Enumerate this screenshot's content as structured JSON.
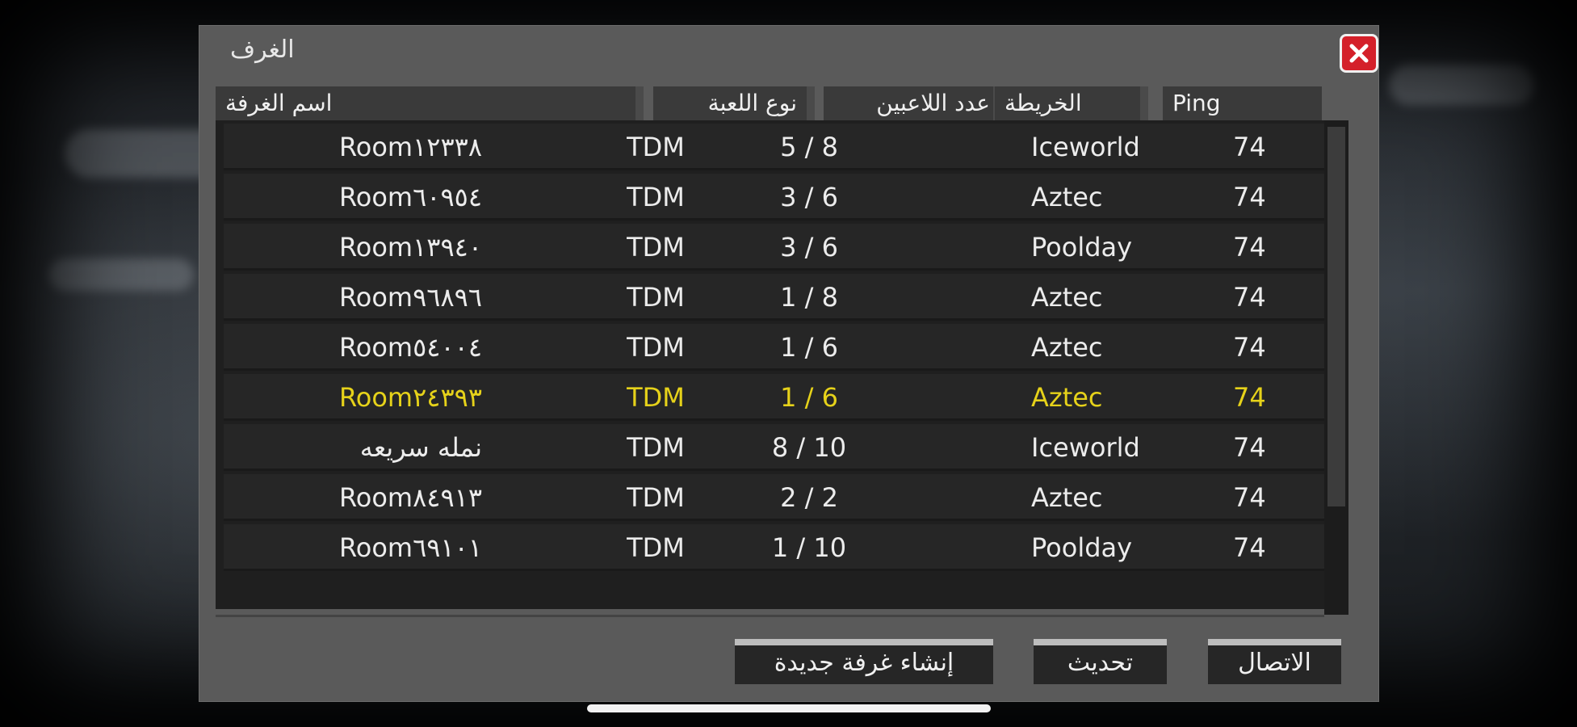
{
  "dialog": {
    "title": "الغرف"
  },
  "columns": {
    "room_name": "اسم الغرفة",
    "game_type": "نوع اللعبة",
    "players": "عدد اللاعبين",
    "map": "الخريطة",
    "ping": "Ping"
  },
  "rooms": [
    {
      "name": "Room١٢٣٣٨",
      "type": "TDM",
      "players": "5 / 8",
      "map": "Iceworld",
      "ping": "74"
    },
    {
      "name": "Room٦٠٩٥٤",
      "type": "TDM",
      "players": "3 / 6",
      "map": "Aztec",
      "ping": "74"
    },
    {
      "name": "Room١٣٩٤٠",
      "type": "TDM",
      "players": "3 / 6",
      "map": "Poolday",
      "ping": "74"
    },
    {
      "name": "Room٩٦٨٩٦",
      "type": "TDM",
      "players": "1 / 8",
      "map": "Aztec",
      "ping": "74"
    },
    {
      "name": "Room٥٤٠٠٤",
      "type": "TDM",
      "players": "1 / 6",
      "map": "Aztec",
      "ping": "74"
    },
    {
      "name": "Room٢٤٣٩٣",
      "type": "TDM",
      "players": "1 / 6",
      "map": "Aztec",
      "ping": "74"
    },
    {
      "name": "نمله سريعه",
      "type": "TDM",
      "players": "8 / 10",
      "map": "Iceworld",
      "ping": "74"
    },
    {
      "name": "Room٨٤٩١٣",
      "type": "TDM",
      "players": "2 / 2",
      "map": "Aztec",
      "ping": "74"
    },
    {
      "name": "Room٦٩١٠١",
      "type": "TDM",
      "players": "1 / 10",
      "map": "Poolday",
      "ping": "74"
    }
  ],
  "selected_row_index": 5,
  "buttons": {
    "create_room": "إنشاء غرفة جديدة",
    "refresh": "تحديث",
    "connect": "الاتصال"
  },
  "icons": {
    "close": "close-icon"
  },
  "colors": {
    "selected_text": "#e6d21a",
    "close_button": "#d4202a"
  }
}
